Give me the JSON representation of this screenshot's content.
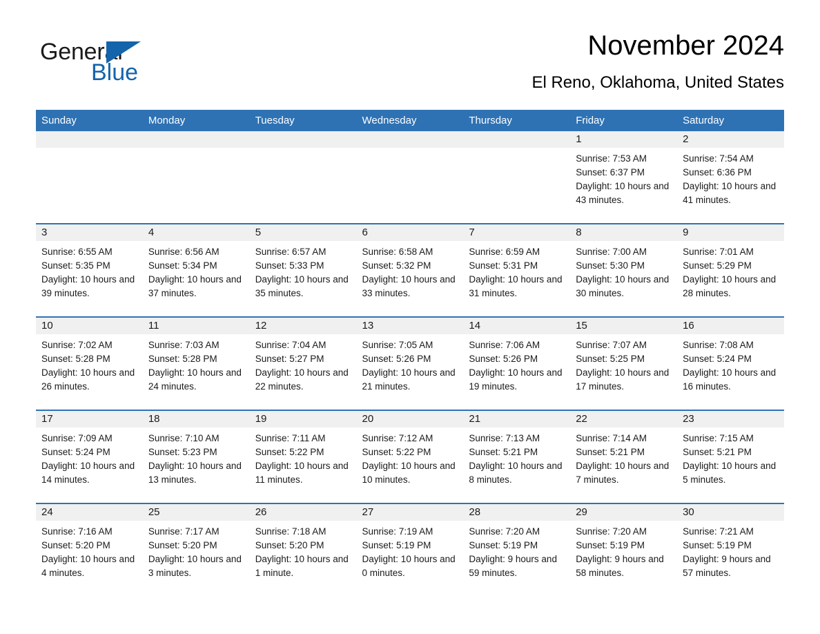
{
  "brand": {
    "name_part1": "General",
    "name_part2": "Blue",
    "triangle_color": "#1464ab",
    "accent_color": "#2e72b4"
  },
  "header": {
    "title": "November 2024",
    "subtitle": "El Reno, Oklahoma, United States"
  },
  "calendar": {
    "weekday_headers": [
      "Sunday",
      "Monday",
      "Tuesday",
      "Wednesday",
      "Thursday",
      "Friday",
      "Saturday"
    ],
    "header_bg": "#2e72b4",
    "header_text_color": "#ffffff",
    "daynum_bg": "#f0f0f0",
    "row_divider_color": "#2e72b4",
    "weeks": [
      [
        {
          "day": "",
          "sunrise": "",
          "sunset": "",
          "daylight": ""
        },
        {
          "day": "",
          "sunrise": "",
          "sunset": "",
          "daylight": ""
        },
        {
          "day": "",
          "sunrise": "",
          "sunset": "",
          "daylight": ""
        },
        {
          "day": "",
          "sunrise": "",
          "sunset": "",
          "daylight": ""
        },
        {
          "day": "",
          "sunrise": "",
          "sunset": "",
          "daylight": ""
        },
        {
          "day": "1",
          "sunrise": "Sunrise: 7:53 AM",
          "sunset": "Sunset: 6:37 PM",
          "daylight": "Daylight: 10 hours and 43 minutes."
        },
        {
          "day": "2",
          "sunrise": "Sunrise: 7:54 AM",
          "sunset": "Sunset: 6:36 PM",
          "daylight": "Daylight: 10 hours and 41 minutes."
        }
      ],
      [
        {
          "day": "3",
          "sunrise": "Sunrise: 6:55 AM",
          "sunset": "Sunset: 5:35 PM",
          "daylight": "Daylight: 10 hours and 39 minutes."
        },
        {
          "day": "4",
          "sunrise": "Sunrise: 6:56 AM",
          "sunset": "Sunset: 5:34 PM",
          "daylight": "Daylight: 10 hours and 37 minutes."
        },
        {
          "day": "5",
          "sunrise": "Sunrise: 6:57 AM",
          "sunset": "Sunset: 5:33 PM",
          "daylight": "Daylight: 10 hours and 35 minutes."
        },
        {
          "day": "6",
          "sunrise": "Sunrise: 6:58 AM",
          "sunset": "Sunset: 5:32 PM",
          "daylight": "Daylight: 10 hours and 33 minutes."
        },
        {
          "day": "7",
          "sunrise": "Sunrise: 6:59 AM",
          "sunset": "Sunset: 5:31 PM",
          "daylight": "Daylight: 10 hours and 31 minutes."
        },
        {
          "day": "8",
          "sunrise": "Sunrise: 7:00 AM",
          "sunset": "Sunset: 5:30 PM",
          "daylight": "Daylight: 10 hours and 30 minutes."
        },
        {
          "day": "9",
          "sunrise": "Sunrise: 7:01 AM",
          "sunset": "Sunset: 5:29 PM",
          "daylight": "Daylight: 10 hours and 28 minutes."
        }
      ],
      [
        {
          "day": "10",
          "sunrise": "Sunrise: 7:02 AM",
          "sunset": "Sunset: 5:28 PM",
          "daylight": "Daylight: 10 hours and 26 minutes."
        },
        {
          "day": "11",
          "sunrise": "Sunrise: 7:03 AM",
          "sunset": "Sunset: 5:28 PM",
          "daylight": "Daylight: 10 hours and 24 minutes."
        },
        {
          "day": "12",
          "sunrise": "Sunrise: 7:04 AM",
          "sunset": "Sunset: 5:27 PM",
          "daylight": "Daylight: 10 hours and 22 minutes."
        },
        {
          "day": "13",
          "sunrise": "Sunrise: 7:05 AM",
          "sunset": "Sunset: 5:26 PM",
          "daylight": "Daylight: 10 hours and 21 minutes."
        },
        {
          "day": "14",
          "sunrise": "Sunrise: 7:06 AM",
          "sunset": "Sunset: 5:26 PM",
          "daylight": "Daylight: 10 hours and 19 minutes."
        },
        {
          "day": "15",
          "sunrise": "Sunrise: 7:07 AM",
          "sunset": "Sunset: 5:25 PM",
          "daylight": "Daylight: 10 hours and 17 minutes."
        },
        {
          "day": "16",
          "sunrise": "Sunrise: 7:08 AM",
          "sunset": "Sunset: 5:24 PM",
          "daylight": "Daylight: 10 hours and 16 minutes."
        }
      ],
      [
        {
          "day": "17",
          "sunrise": "Sunrise: 7:09 AM",
          "sunset": "Sunset: 5:24 PM",
          "daylight": "Daylight: 10 hours and 14 minutes."
        },
        {
          "day": "18",
          "sunrise": "Sunrise: 7:10 AM",
          "sunset": "Sunset: 5:23 PM",
          "daylight": "Daylight: 10 hours and 13 minutes."
        },
        {
          "day": "19",
          "sunrise": "Sunrise: 7:11 AM",
          "sunset": "Sunset: 5:22 PM",
          "daylight": "Daylight: 10 hours and 11 minutes."
        },
        {
          "day": "20",
          "sunrise": "Sunrise: 7:12 AM",
          "sunset": "Sunset: 5:22 PM",
          "daylight": "Daylight: 10 hours and 10 minutes."
        },
        {
          "day": "21",
          "sunrise": "Sunrise: 7:13 AM",
          "sunset": "Sunset: 5:21 PM",
          "daylight": "Daylight: 10 hours and 8 minutes."
        },
        {
          "day": "22",
          "sunrise": "Sunrise: 7:14 AM",
          "sunset": "Sunset: 5:21 PM",
          "daylight": "Daylight: 10 hours and 7 minutes."
        },
        {
          "day": "23",
          "sunrise": "Sunrise: 7:15 AM",
          "sunset": "Sunset: 5:21 PM",
          "daylight": "Daylight: 10 hours and 5 minutes."
        }
      ],
      [
        {
          "day": "24",
          "sunrise": "Sunrise: 7:16 AM",
          "sunset": "Sunset: 5:20 PM",
          "daylight": "Daylight: 10 hours and 4 minutes."
        },
        {
          "day": "25",
          "sunrise": "Sunrise: 7:17 AM",
          "sunset": "Sunset: 5:20 PM",
          "daylight": "Daylight: 10 hours and 3 minutes."
        },
        {
          "day": "26",
          "sunrise": "Sunrise: 7:18 AM",
          "sunset": "Sunset: 5:20 PM",
          "daylight": "Daylight: 10 hours and 1 minute."
        },
        {
          "day": "27",
          "sunrise": "Sunrise: 7:19 AM",
          "sunset": "Sunset: 5:19 PM",
          "daylight": "Daylight: 10 hours and 0 minutes."
        },
        {
          "day": "28",
          "sunrise": "Sunrise: 7:20 AM",
          "sunset": "Sunset: 5:19 PM",
          "daylight": "Daylight: 9 hours and 59 minutes."
        },
        {
          "day": "29",
          "sunrise": "Sunrise: 7:20 AM",
          "sunset": "Sunset: 5:19 PM",
          "daylight": "Daylight: 9 hours and 58 minutes."
        },
        {
          "day": "30",
          "sunrise": "Sunrise: 7:21 AM",
          "sunset": "Sunset: 5:19 PM",
          "daylight": "Daylight: 9 hours and 57 minutes."
        }
      ]
    ]
  }
}
